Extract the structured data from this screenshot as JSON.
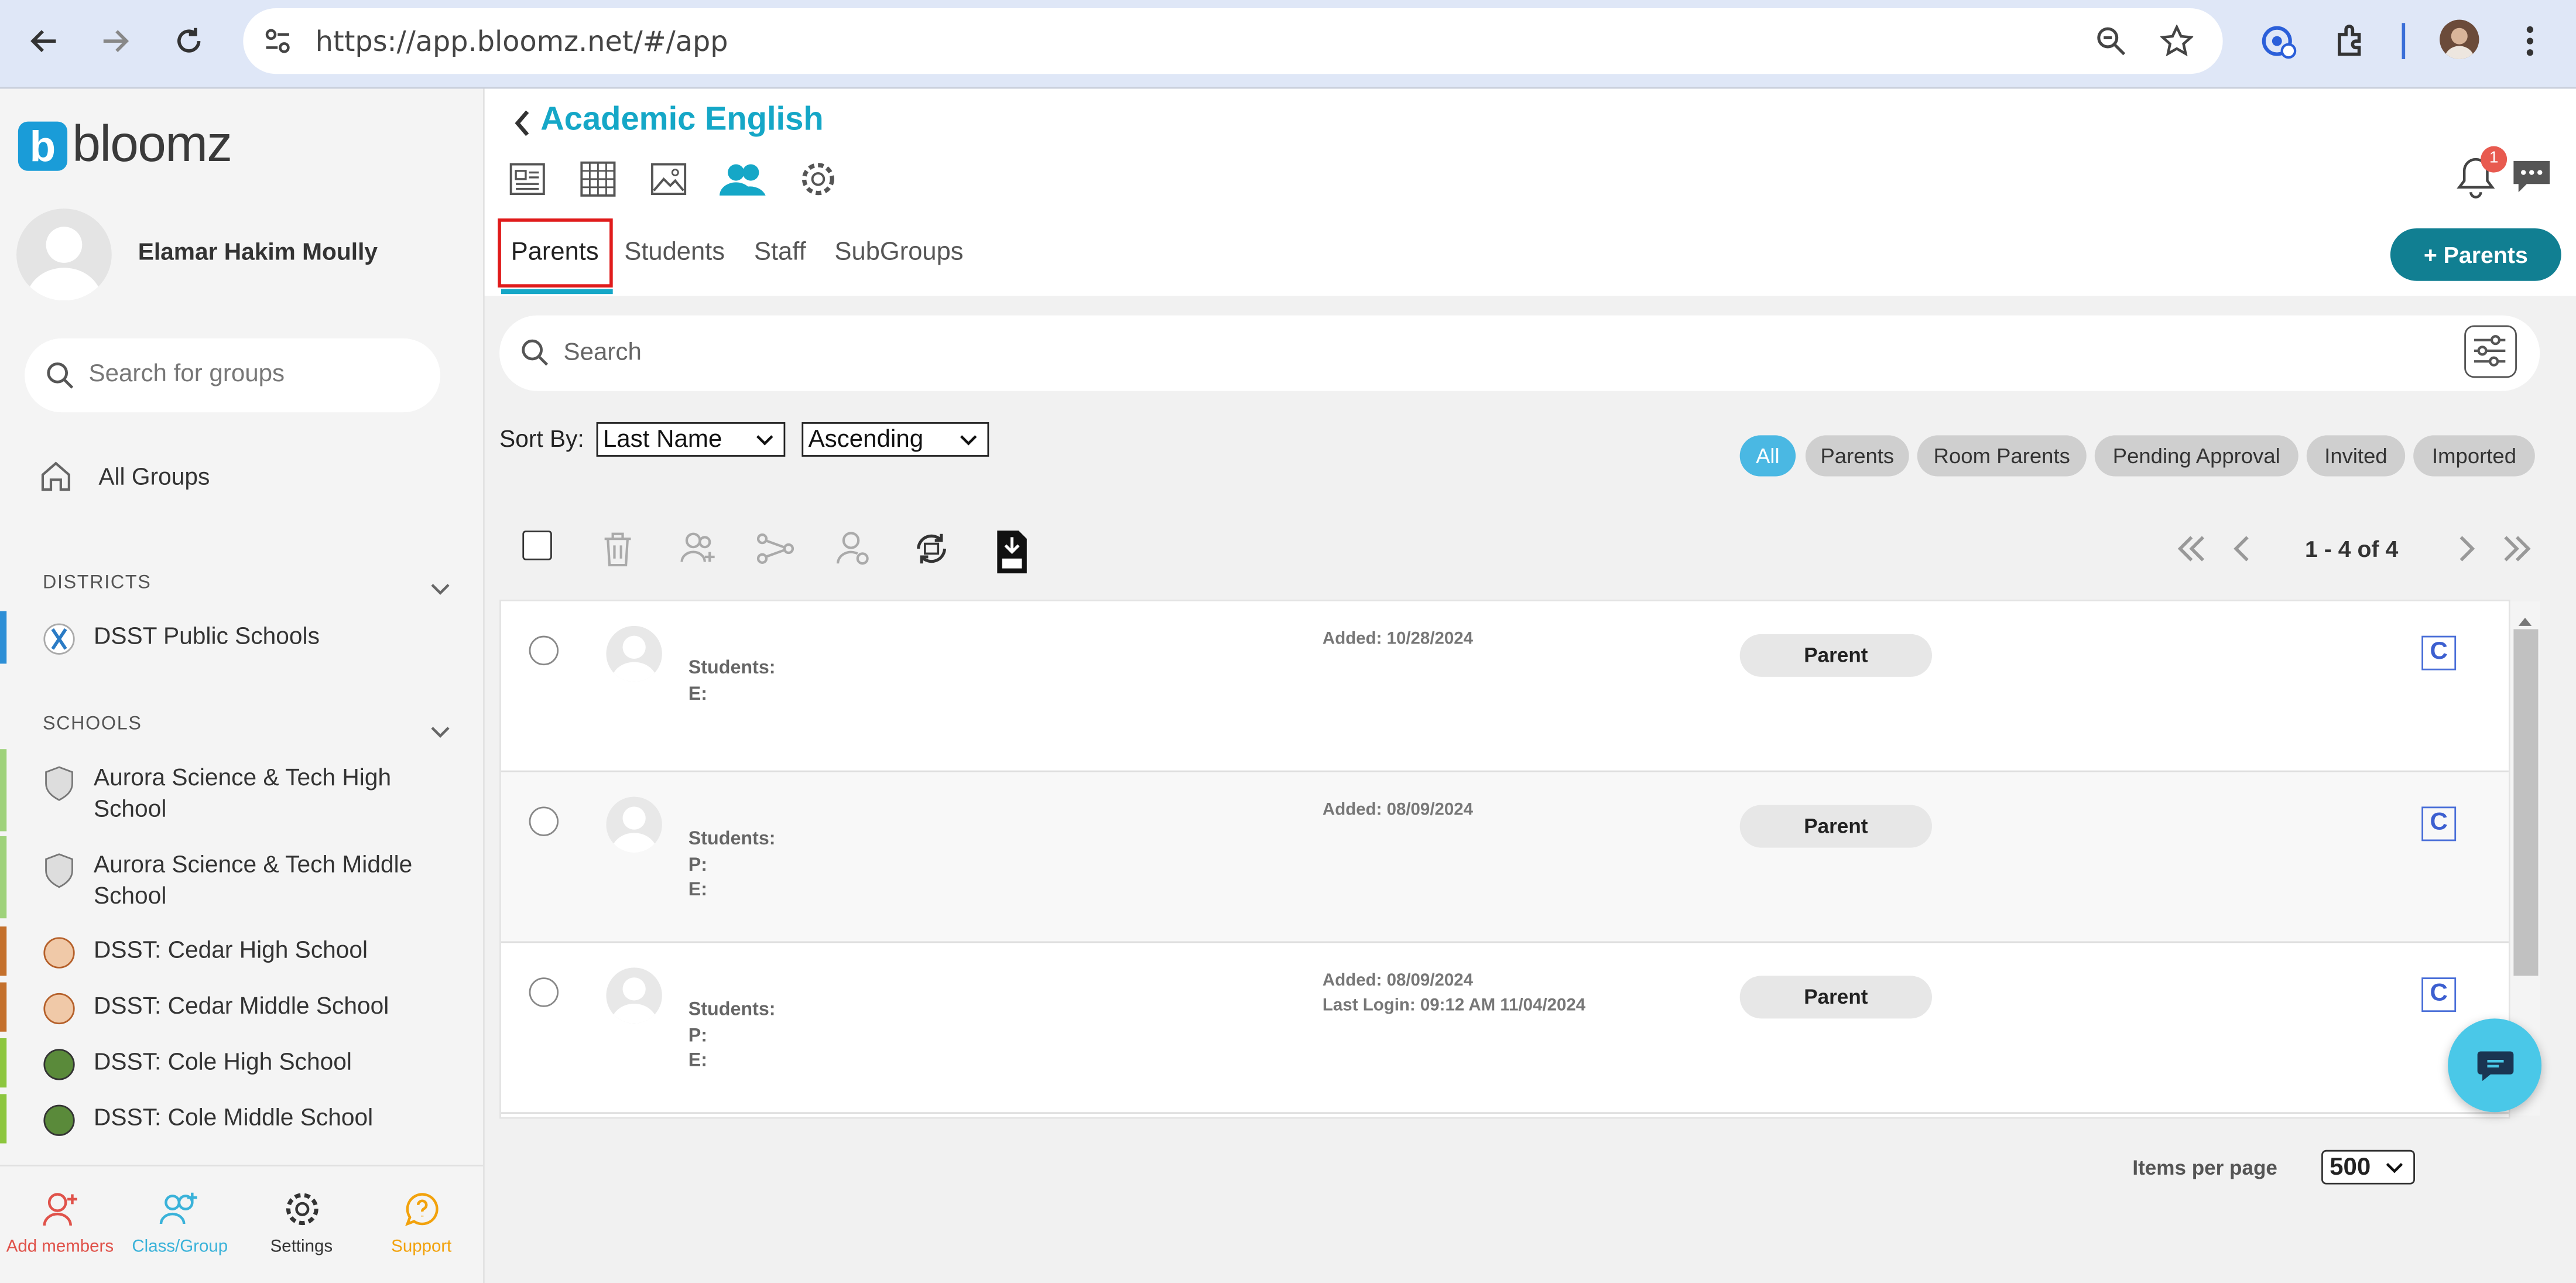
{
  "browser": {
    "url": "https://app.bloomz.net/#/app"
  },
  "sidebar": {
    "logo_text": "bloomz",
    "logo_letter": "b",
    "user_name": "Elamar Hakim Moully",
    "search_placeholder": "Search for groups",
    "all_groups": "All Groups",
    "districts_heading": "DISTRICTS",
    "districts": [
      {
        "name": "DSST Public Schools"
      }
    ],
    "schools_heading": "SCHOOLS",
    "schools": [
      {
        "name": "Aurora Science & Tech High School",
        "color": "#9ed27a"
      },
      {
        "name": "Aurora Science & Tech Middle School",
        "color": "#9ed27a"
      },
      {
        "name": "DSST: Cedar High School",
        "color": "#c4702c"
      },
      {
        "name": "DSST: Cedar Middle School",
        "color": "#c4702c"
      },
      {
        "name": "DSST: Cole High School",
        "color": "#8cc63e"
      },
      {
        "name": "DSST: Cole Middle School",
        "color": "#8cc63e"
      }
    ],
    "bottom_nav": [
      {
        "label": "Add members",
        "color": "#e0524a"
      },
      {
        "label": "Class/Group",
        "color": "#3ab2d9"
      },
      {
        "label": "Settings",
        "color": "#333333"
      },
      {
        "label": "Support",
        "color": "#f2a20c"
      }
    ]
  },
  "header": {
    "group_title": "Academic English",
    "notification_count": "1",
    "tabs": [
      {
        "label": "Parents",
        "active": true
      },
      {
        "label": "Students"
      },
      {
        "label": "Staff"
      },
      {
        "label": "SubGroups"
      }
    ],
    "add_button": "+ Parents"
  },
  "filters": {
    "search_placeholder": "Search",
    "sort_by_label": "Sort By:",
    "sort_field": "Last Name",
    "sort_order": "Ascending",
    "chips": [
      "All",
      "Parents",
      "Room Parents",
      "Pending Approval",
      "Invited",
      "Imported"
    ]
  },
  "pager": {
    "text": "1 - 4 of 4"
  },
  "rows": [
    {
      "students": "Students:",
      "lines": [
        "E:"
      ],
      "added": "Added: 10/28/2024",
      "last_login": "",
      "role": "Parent",
      "c": "C"
    },
    {
      "students": "Students:",
      "lines": [
        "P:",
        "E:"
      ],
      "added": "Added: 08/09/2024",
      "last_login": "",
      "role": "Parent",
      "c": "C"
    },
    {
      "students": "Students:",
      "lines": [
        "P:",
        "E:"
      ],
      "added": "Added: 08/09/2024",
      "last_login": "Last Login: 09:12 AM 11/04/2024",
      "role": "Parent",
      "c": "C"
    }
  ],
  "footer": {
    "items_per_page_label": "Items per page",
    "items_per_page_value": "500"
  },
  "colors": {
    "accent": "#15a7c7",
    "primary_button": "#117f92",
    "active_chip": "#4ab8e3",
    "tab_highlight": "#e01b1b"
  }
}
